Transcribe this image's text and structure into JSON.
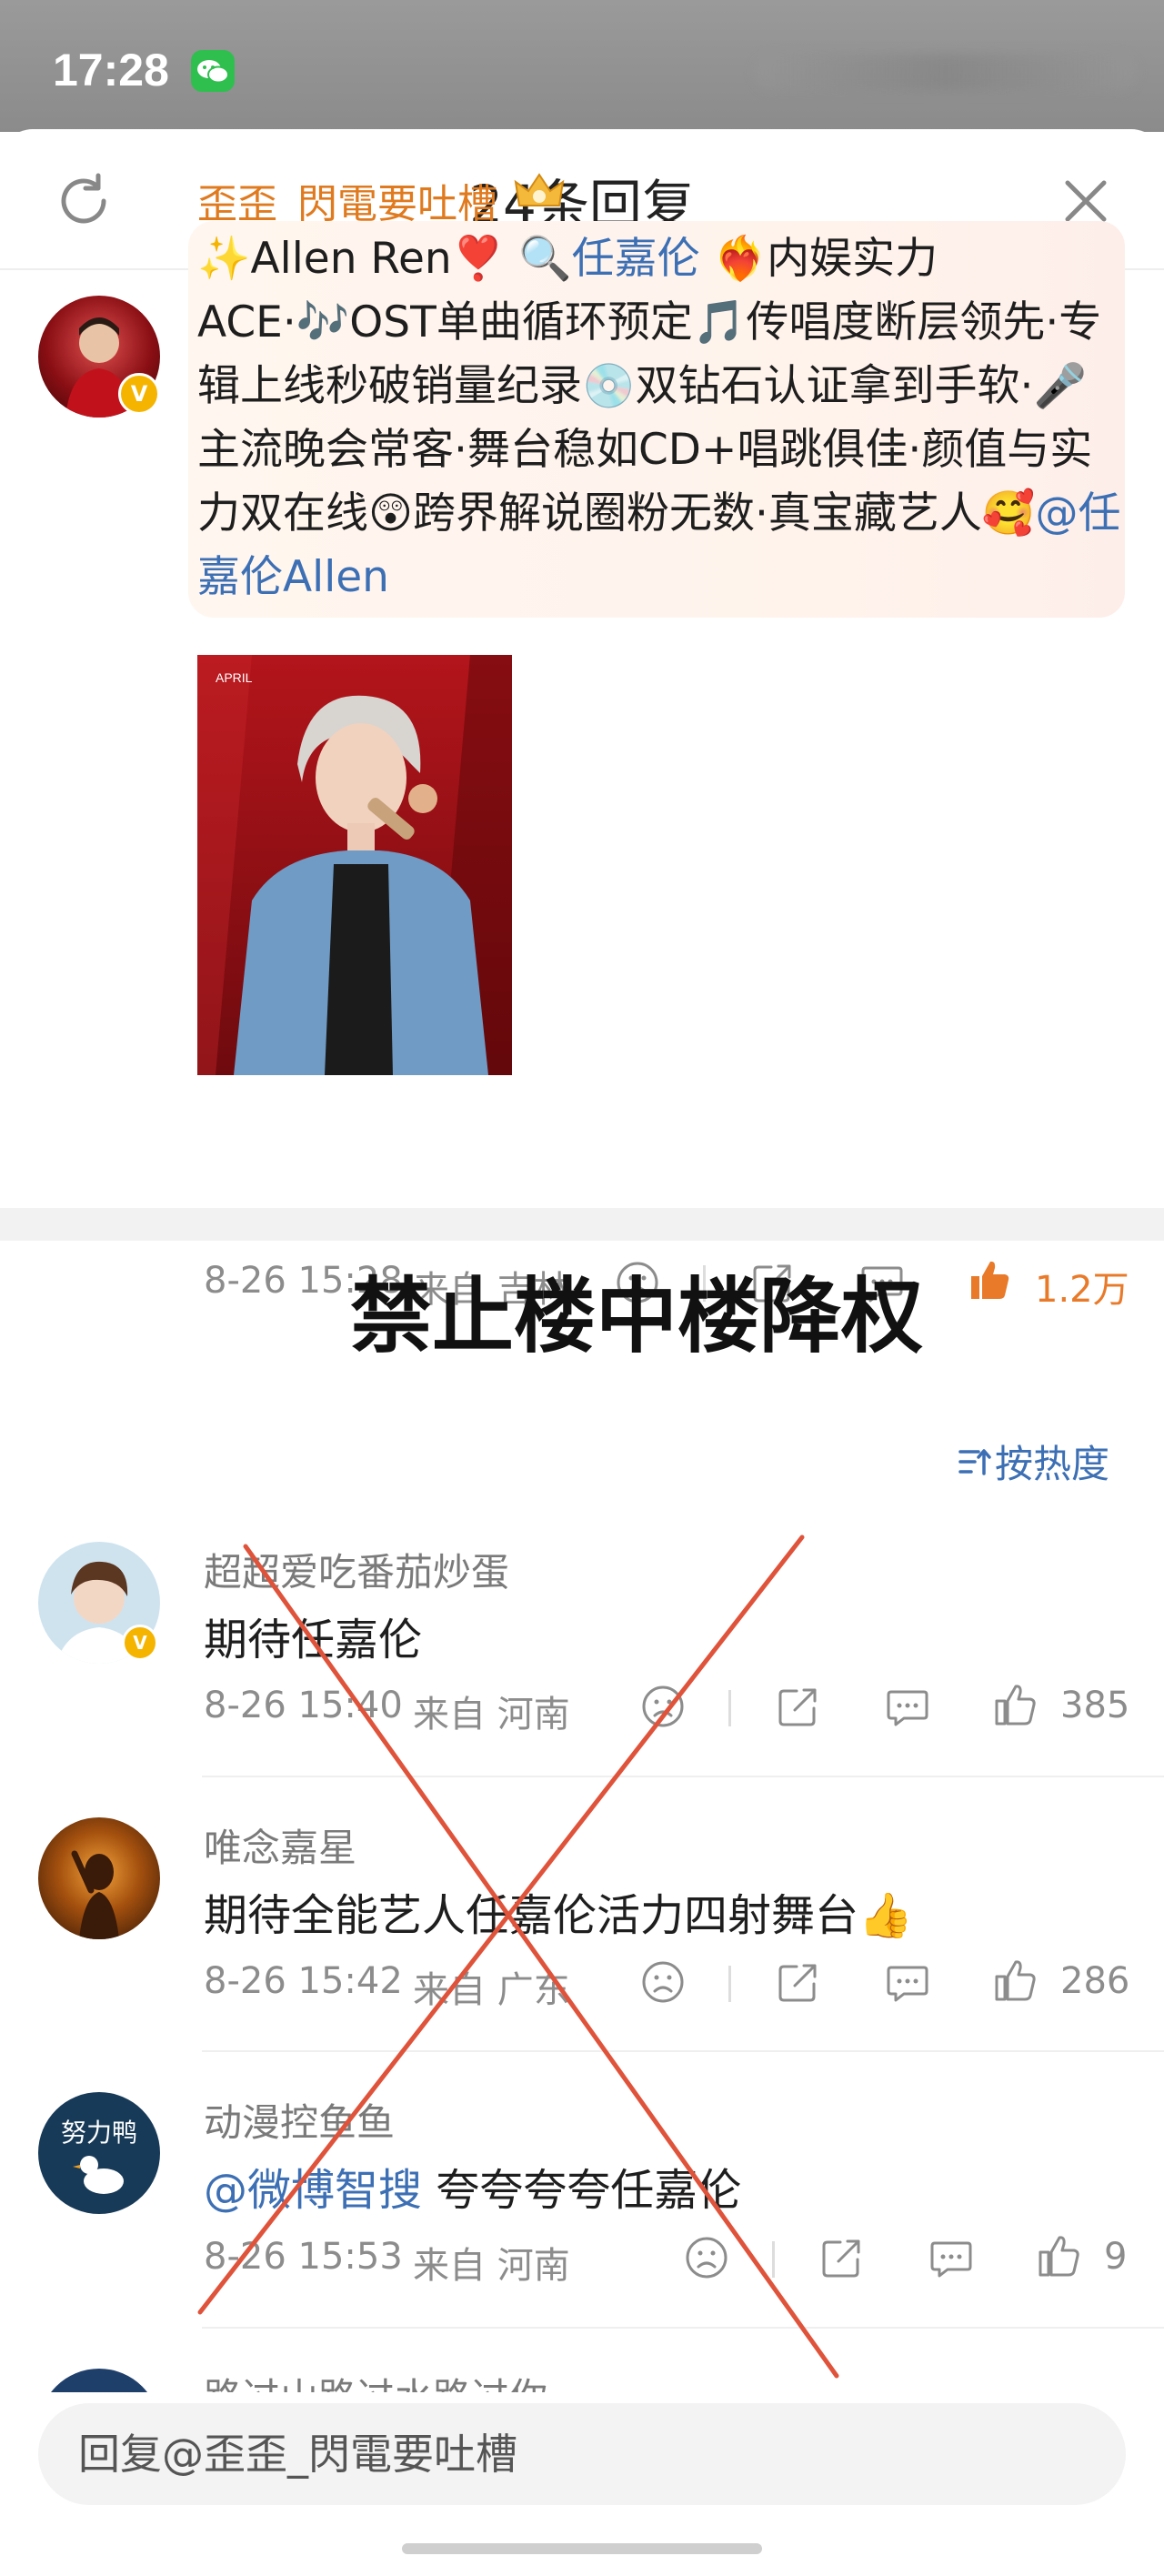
{
  "status_bar": {
    "time": "17:28"
  },
  "sheet": {
    "title": "24条回复",
    "refresh_icon": "refresh-icon",
    "close_icon": "close-icon"
  },
  "main_comment": {
    "username": "歪歪_閃電要吐槽",
    "text_parts": [
      {
        "t": "✨Allen Ren❣️ ",
        "c": "text"
      },
      {
        "t": "🔍任嘉伦",
        "c": "topic"
      },
      {
        "t": " ❤️‍🔥内娱实力ACE·🎶OST单曲循环预定🎵传唱度断层领先·专辑上线秒破销量纪录💿双钻石认证拿到手软·🎤主流晚会常客·舞台稳如CD+唱跳俱佳·颜值与实力双在线😲跨界解说圈粉无数·真宝藏艺人🥰",
        "c": "text"
      },
      {
        "t": "@任嘉伦Allen",
        "c": "mention"
      }
    ],
    "time": "8-26 15:28",
    "location": "来自 吉林",
    "likes": "1.2万",
    "like_color": "#e87a2a"
  },
  "overlay": {
    "banner": "禁止楼中楼降权",
    "cross_color": "#e0533b"
  },
  "sort_label": "按热度",
  "replies": [
    {
      "username": "超超爱吃番茄炒蛋",
      "text_parts": [
        {
          "t": "期待任嘉伦",
          "c": "text"
        }
      ],
      "time": "8-26 15:40",
      "location": "来自 河南",
      "likes": "385"
    },
    {
      "username": "唯念嘉星",
      "text_parts": [
        {
          "t": "期待全能艺人任嘉伦活力四射舞台👍",
          "c": "text"
        }
      ],
      "time": "8-26 15:42",
      "location": "来自 广东",
      "likes": "286"
    },
    {
      "username": "动漫控鱼鱼",
      "text_parts": [
        {
          "t": "@微博智搜",
          "c": "mention"
        },
        {
          "t": " 夸夸夸夸任嘉伦",
          "c": "text"
        }
      ],
      "time": "8-26 15:53",
      "location": "来自 河南",
      "likes": "9"
    }
  ],
  "partial_reply_name": "路过山路过水路过你",
  "reply_input": {
    "placeholder": "回复@歪歪_閃電要吐槽"
  },
  "icons": {
    "emoji": "sad-face-icon",
    "share": "share-icon",
    "comment": "comment-icon",
    "like": "thumbs-up-icon"
  }
}
